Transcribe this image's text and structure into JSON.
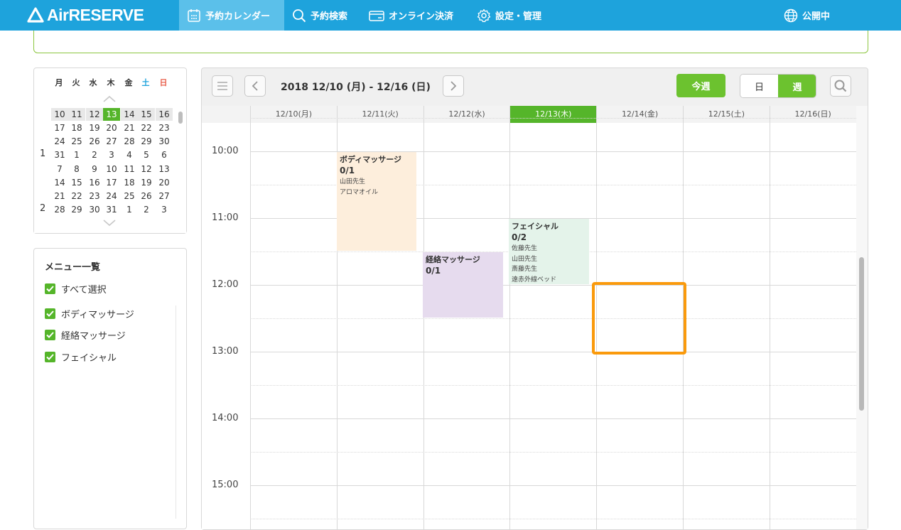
{
  "app": {
    "logo_text": "AirRESERVE"
  },
  "nav": [
    {
      "label": "予約カレンダー",
      "icon": "calendar-icon",
      "active": true
    },
    {
      "label": "予約検索",
      "icon": "search-icon",
      "active": false
    },
    {
      "label": "オンライン決済",
      "icon": "card-icon",
      "active": false
    },
    {
      "label": "設定・管理",
      "icon": "gear-icon",
      "active": false
    }
  ],
  "status": {
    "label": "公開中",
    "icon": "globe-icon"
  },
  "mini_calendar": {
    "weekdays": [
      "月",
      "火",
      "水",
      "木",
      "金",
      "土",
      "日"
    ],
    "month_labels": [
      "1",
      "2"
    ],
    "weeks": [
      [
        "10",
        "11",
        "12",
        "13",
        "14",
        "15",
        "16"
      ],
      [
        "17",
        "18",
        "19",
        "20",
        "21",
        "22",
        "23"
      ],
      [
        "24",
        "25",
        "26",
        "27",
        "28",
        "29",
        "30"
      ],
      [
        "31",
        "1",
        "2",
        "3",
        "4",
        "5",
        "6"
      ],
      [
        "7",
        "8",
        "9",
        "10",
        "11",
        "12",
        "13"
      ],
      [
        "14",
        "15",
        "16",
        "17",
        "18",
        "19",
        "20"
      ],
      [
        "21",
        "22",
        "23",
        "24",
        "25",
        "26",
        "27"
      ],
      [
        "28",
        "29",
        "30",
        "31",
        "1",
        "2",
        "3"
      ]
    ]
  },
  "menu": {
    "title": "メニュー一覧",
    "select_all": "すべて選択",
    "items": [
      "ボディマッサージ",
      "経絡マッサージ",
      "フェイシャル"
    ]
  },
  "toolbar": {
    "date_range": "2018 12/10 (月) - 12/16 (日)",
    "this_week": "今週",
    "day": "日",
    "week": "週"
  },
  "calendar": {
    "days": [
      "12/10(月)",
      "12/11(火)",
      "12/12(水)",
      "12/13(木)",
      "12/14(金)",
      "12/15(土)",
      "12/16(日)"
    ],
    "today_index": 3,
    "times": [
      "10:00",
      "11:00",
      "12:00",
      "13:00",
      "14:00",
      "15:00"
    ],
    "events": [
      {
        "name": "ボディマッサージ",
        "count": "0/1",
        "details": [
          "山田先生",
          "アロマオイル"
        ],
        "color": "#fdeedc"
      },
      {
        "name": "フェイシャル",
        "count": "0/2",
        "details": [
          "佐藤先生",
          "山田先生",
          "斎藤先生",
          "遠赤外線ベッド"
        ],
        "color": "#e4f3ea"
      },
      {
        "name": "経絡マッサージ",
        "count": "0/1",
        "details": [],
        "color": "#e6dbee"
      }
    ]
  },
  "colors": {
    "header": "#1ea3dc",
    "accent_green": "#55b52a",
    "selection": "#fa9a0c"
  }
}
